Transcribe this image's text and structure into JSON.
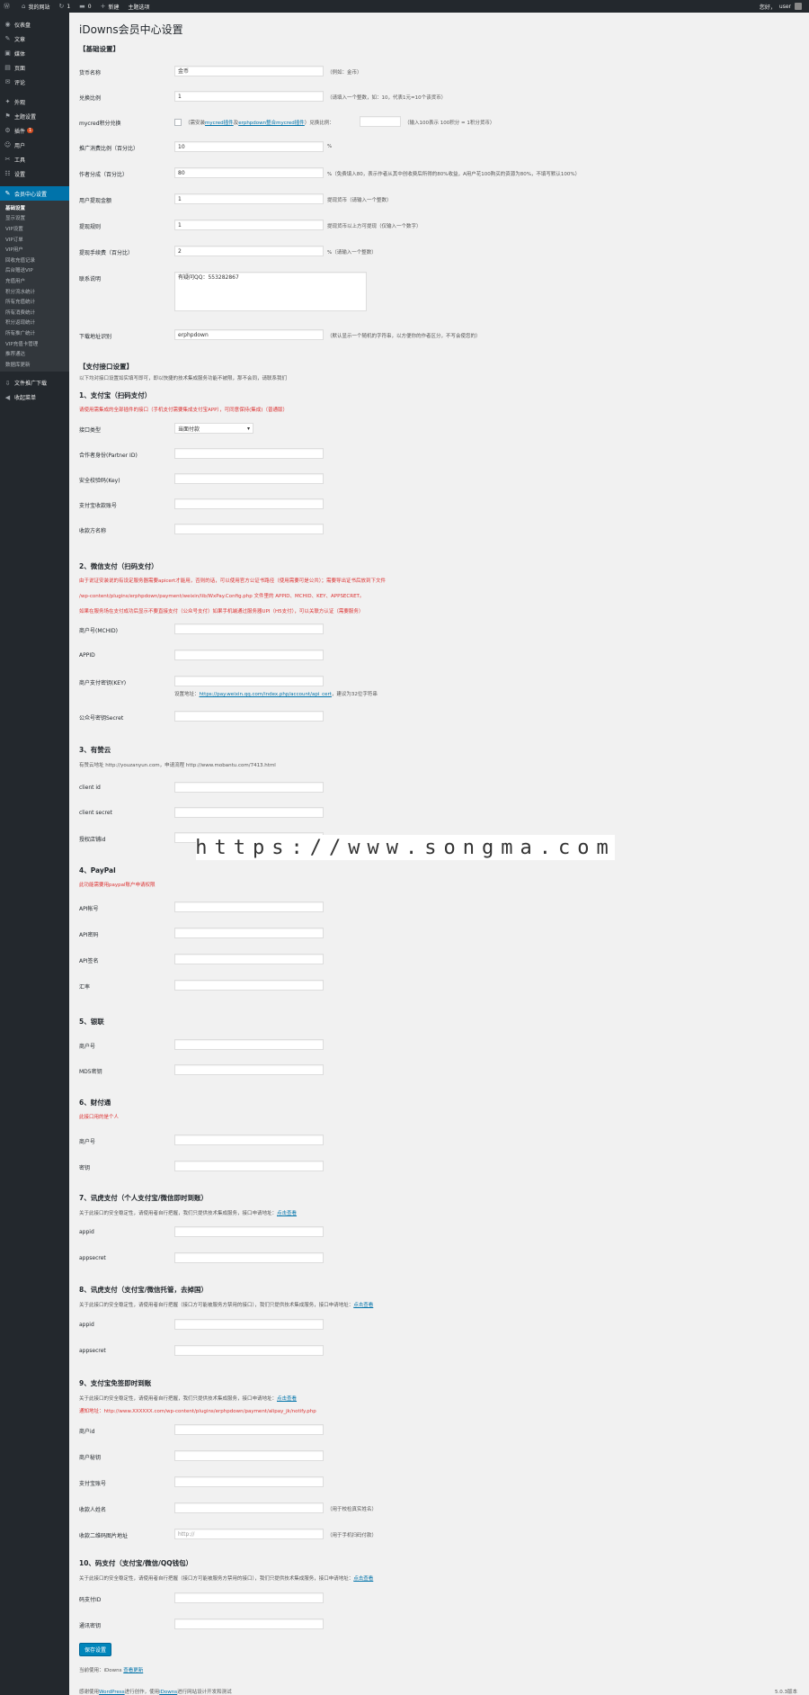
{
  "topbar": {
    "site": "我的网站",
    "updates": "1",
    "comments": "0",
    "new": "新建",
    "theme": "主题选项",
    "greeting": "您好，",
    "user": "user"
  },
  "sidebar": {
    "items": [
      {
        "icon": "dashboard-icon",
        "glyph": "◉",
        "label": "仪表盘"
      },
      {
        "icon": "posts-icon",
        "glyph": "✎",
        "label": "文章"
      },
      {
        "icon": "media-icon",
        "glyph": "▣",
        "label": "媒体"
      },
      {
        "icon": "pages-icon",
        "glyph": "▤",
        "label": "页面"
      },
      {
        "icon": "comments-icon",
        "glyph": "✉",
        "label": "评论"
      },
      {
        "icon": "appearance-icon",
        "glyph": "✦",
        "label": "外观"
      },
      {
        "icon": "theme-options-icon",
        "glyph": "⚑",
        "label": "主题设置"
      },
      {
        "icon": "plugins-icon",
        "glyph": "⚙",
        "label": "插件",
        "badge": "1"
      },
      {
        "icon": "users-icon",
        "glyph": "☺",
        "label": "用户"
      },
      {
        "icon": "tools-icon",
        "glyph": "✂",
        "label": "工具"
      },
      {
        "icon": "settings-icon",
        "glyph": "☷",
        "label": "设置"
      },
      {
        "icon": "member-center-icon",
        "glyph": "✎",
        "label": "会员中心设置"
      }
    ],
    "subitems": [
      "基础设置",
      "显示设置",
      "VIP设置",
      "VIP订单",
      "VIP用户",
      "回收充值记录",
      "后台赠送VIP",
      "充值用户",
      "积分流水统计",
      "所有充值统计",
      "所有消费统计",
      "积分返现统计",
      "所有推广统计",
      "VIP充值卡管理",
      "推荐通达",
      "数据库更新"
    ],
    "extra": [
      {
        "icon": "download-icon",
        "glyph": "⇩",
        "label": "文件推广下载"
      },
      {
        "icon": "collapse-icon",
        "glyph": "◀",
        "label": "收起菜单"
      }
    ]
  },
  "page": {
    "title": "iDowns会员中心设置",
    "basic_heading": "【基础设置】",
    "currency_name_label": "货币名称",
    "currency_name_value": "金币",
    "currency_name_desc": "（例如：金币）",
    "rate_label": "兑换比例",
    "rate_value": "1",
    "rate_desc": "（请填入一个整数，如：10，代表1元=10个该货币）",
    "mycred_label": "mycred积分兑换",
    "mycred_desc_a": "（需安装",
    "mycred_link1": "mycred插件",
    "mycred_desc_b": "及",
    "mycred_link2": "erphpdown整合mycred插件",
    "mycred_desc_c": "）兑换比例：",
    "mycred_desc_d": "（输入100表示 100积分 = 1积分货币）",
    "ali_rate_label": "推广消费比例（百分比）",
    "ali_rate_value": "10",
    "ali_rate_desc": "%",
    "author_rate_label": "作者分成（百分比）",
    "author_rate_value": "80",
    "author_rate_desc": "%（免费填入80，表示作者从其中创收费后所得的80%收益，A用户花100购买的资源为80%，不填写默认100%）",
    "min_withdraw_label": "用户提现金额",
    "min_withdraw_value": "1",
    "min_withdraw_desc": "提现货币（请输入一个整数）",
    "withdraw_rule_label": "提现规则",
    "withdraw_rule_value": "1",
    "withdraw_rule_desc": "提现货币以上方可提现（仅输入一个数字）",
    "fee_label": "提现手续费（百分比）",
    "fee_value": "2",
    "fee_desc": "%（请输入一个整数）",
    "contact_label": "联系说明",
    "contact_value": "有疑问QQ：553282867",
    "download_label": "下载地址识别",
    "download_value": "erphpdown",
    "download_desc": "（默认显示一个随机的字符串，以方便你的作者区分，不写会使您的）",
    "pay_heading": "【支付接口设置】",
    "pay_note": "以下均对接口设置如实填写即可，即以快捷的技术集成服务功能不被限，那不会同，请联系我们",
    "alipay": {
      "heading": "1、支付宝（扫码支付）",
      "red": "请使用需集成的全部插件的接口（手机支付需要集成支付宝APP），可同意保持(集成)（普通版）",
      "type_label": "接口类型",
      "type_value": "当面付款",
      "partner_label": "合作者身份(Partner ID)",
      "key_label": "安全校验码(Key)",
      "account_label": "支付宝收款账号",
      "seller_label": "收款方名称"
    },
    "wechat": {
      "heading": "2、微信支付（扫码支付）",
      "red1": "由于说证安装说的有设定服务器需要apicert才能用，否则的话，可以使用官方公证书路径（使用需要可是公共）；需要导出证书后放到下文件",
      "red2": "/wp-content/plugins/erphpdown/payment/weixin/lib/WxPay.Config.php 文件里的 APPID、MCHID、KEY、APPSECRET。",
      "red3": "如果在服务场在支付成功后显示不要直接支付（公众号支付）如果手机端通过服务器UPI（H5支付），可以关联方认证（需要服务）",
      "mch_label": "商户号(MCHID)",
      "appid_label": "APPID",
      "key_label": "商户支付密钥(KEY)",
      "key_desc_a": "设置地址：",
      "key_link": "https://pay.weixin.qq.com/index.php/account/api_cert",
      "key_desc_b": "，建议为32位字符串",
      "secret_label": "公众号密钥Secret"
    },
    "youzan": {
      "heading": "3、有赞云",
      "note": "有赞云地址 http://youzanyun.com，申请流程 http://www.mobantu.com/7413.html",
      "id_label": "client id",
      "secret_label": "client secret",
      "shop_label": "授权店铺id"
    },
    "paypal": {
      "heading": "4、PayPal",
      "red": "此功能需要用paypal账户申请权限",
      "api_label": "API帐号",
      "pwd_label": "API密码",
      "sig_label": "API签名",
      "rate_label": "汇率"
    },
    "chinabank": {
      "heading": "5、银联",
      "mch_label": "商户号",
      "md5_label": "MD5密钥"
    },
    "tenpay": {
      "heading": "6、财付通",
      "red": "此接口用的是个人",
      "id_label": "商户号",
      "key_label": "密钥"
    },
    "xunhu1": {
      "heading": "7、讯虎支付（个人支付宝/微信即时到账）",
      "note_a": "关于此接口的安全稳定性，请使用者自行把握，我们只提供技术集成服务，接口申请地址：",
      "note_link": "点击查看",
      "appid_label": "appid",
      "secret_label": "appsecret"
    },
    "xunhu2": {
      "heading": "8、讯虎支付（支付宝/微信托管，去掉国）",
      "note_a": "关于此接口的安全稳定性，请使用者自行把握（接口方可能被服务方禁用的接口），我们只提供技术集成服务，接口申请地址：",
      "note_link": "点击查看",
      "appid_label": "appid",
      "secret_label": "appsecret"
    },
    "f2f": {
      "heading": "9、支付宝免签即时到账",
      "note_a": "关于此接口的安全稳定性，请使用者自行把握，我们只提供技术集成服务，接口申请地址：",
      "note_link": "点击查看",
      "red": "通知地址：http://www.XXXXXX.com/wp-content/plugins/erphpdown/payment/alipay_jk/notify.php",
      "id_label": "商户id",
      "key_label": "商户秘钥",
      "acc_label": "支付宝账号",
      "name_label": "收款人姓名",
      "name_desc": "（用于校检真实姓名）",
      "qr_label": "收款二维码图片地址",
      "qr_value": "http://",
      "qr_desc": "（用于手机扫码付款）"
    },
    "codepay": {
      "heading": "10、码支付（支付宝/微信/QQ钱包）",
      "note_a": "关于此接口的安全稳定性，请使用者自行把握（接口方可能被服务方禁用的接口），我们只提供技术集成服务，接口申请地址：",
      "note_link": "点击查看",
      "id_label": "码支付ID",
      "key_label": "通讯密钥"
    },
    "save_button": "保存设置",
    "version_a": "当前使用：iDowns ",
    "version_link": "查看更新"
  },
  "footer": {
    "thanks_a": "感谢使用",
    "wp_link": "WordPress",
    "thanks_b": "进行创作，使用",
    "theme_link": "iDowns",
    "thanks_c": "进行网站设计开发和测试",
    "version": "5.0.3版本"
  },
  "watermark": "https://www.songma.com"
}
